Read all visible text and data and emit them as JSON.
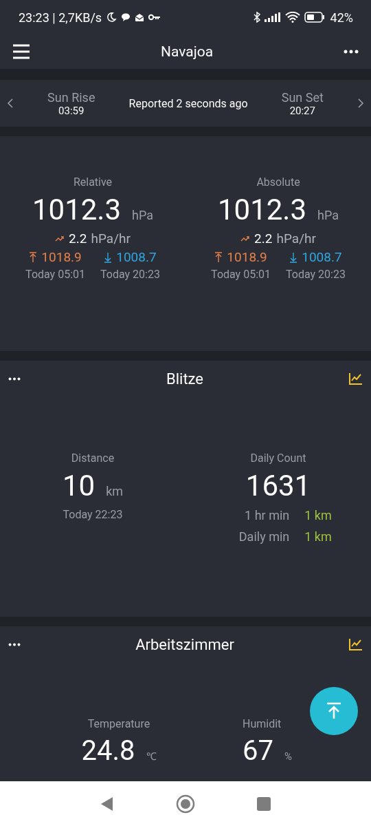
{
  "status_bar": {
    "time": "23:23 | 2,7KB/s",
    "battery": "42%"
  },
  "app_bar": {
    "title": "Navajoa"
  },
  "sun_bar": {
    "sunrise_label": "Sun Rise",
    "sunrise_time": "03:59",
    "reported": "Reported 2 seconds ago",
    "sunset_label": "Sun Set",
    "sunset_time": "20:27"
  },
  "pressure": {
    "columns": [
      {
        "label": "Relative",
        "value": "1012.3",
        "unit": "hPa",
        "trend_value": "2.2",
        "trend_unit": "hPa/hr",
        "high": "1018.9",
        "low": "1008.7",
        "high_time": "Today 05:01",
        "low_time": "Today 20:23"
      },
      {
        "label": "Absolute",
        "value": "1012.3",
        "unit": "hPa",
        "trend_value": "2.2",
        "trend_unit": "hPa/hr",
        "high": "1018.9",
        "low": "1008.7",
        "high_time": "Today 05:01",
        "low_time": "Today 20:23"
      }
    ]
  },
  "lightning": {
    "title": "Blitze",
    "distance": {
      "label": "Distance",
      "value": "10",
      "unit": "km",
      "time": "Today 22:23"
    },
    "count": {
      "label": "Daily Count",
      "value": "1631",
      "rows": [
        {
          "label": "1 hr min",
          "value": "1 km"
        },
        {
          "label": "Daily min",
          "value": "1 km"
        }
      ]
    }
  },
  "room": {
    "title": "Arbeitszimmer",
    "readings": [
      {
        "label": "Temperature",
        "value": "24.8",
        "unit": "℃"
      },
      {
        "label": "Humidit",
        "value": "67",
        "unit": "%"
      }
    ]
  }
}
